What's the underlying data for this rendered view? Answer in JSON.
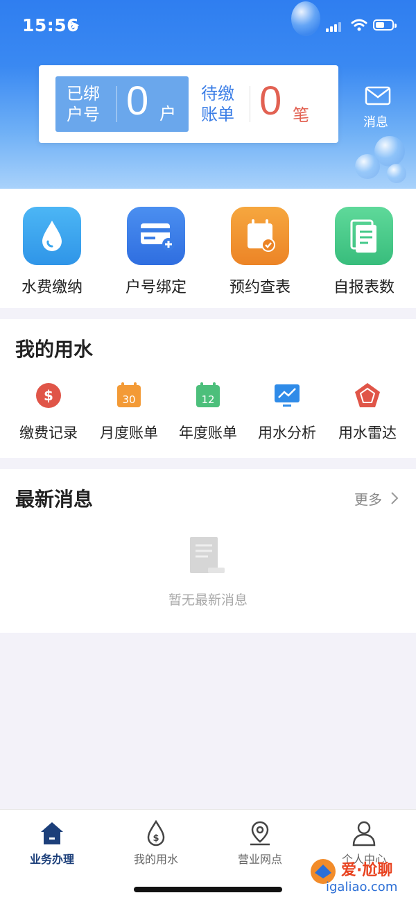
{
  "status_bar": {
    "time": "15:56"
  },
  "header": {
    "bound": {
      "label": "已绑户号",
      "count": "0",
      "unit": "户"
    },
    "pending": {
      "label": "待缴账单",
      "count": "0",
      "unit": "笔"
    },
    "message_label": "消息"
  },
  "services": [
    {
      "label": "水费缴纳",
      "icon": "water-drop-icon",
      "color": "#3aa6ef"
    },
    {
      "label": "户号绑定",
      "icon": "card-add-icon",
      "color": "#3a7de6"
    },
    {
      "label": "预约查表",
      "icon": "calendar-check-icon",
      "color": "#f0922e"
    },
    {
      "label": "自报表数",
      "icon": "document-icon",
      "color": "#44c98a"
    }
  ],
  "my_water": {
    "title": "我的用水",
    "items": [
      {
        "label": "缴费记录",
        "icon": "dollar-icon"
      },
      {
        "label": "月度账单",
        "icon": "calendar-30-icon",
        "badge": "30"
      },
      {
        "label": "年度账单",
        "icon": "calendar-12-icon",
        "badge": "12"
      },
      {
        "label": "用水分析",
        "icon": "chart-monitor-icon"
      },
      {
        "label": "用水雷达",
        "icon": "radar-icon"
      }
    ]
  },
  "news": {
    "title": "最新消息",
    "more_label": "更多",
    "empty_text": "暂无最新消息"
  },
  "tabbar": {
    "items": [
      {
        "label": "业务办理",
        "icon": "home-icon",
        "active": true
      },
      {
        "label": "我的用水",
        "icon": "water-dollar-icon"
      },
      {
        "label": "营业网点",
        "icon": "location-icon"
      },
      {
        "label": "个人中心",
        "icon": "person-icon"
      }
    ]
  },
  "watermark": {
    "text": "爱·尬聊",
    "sub": "igaliao.com"
  },
  "colors": {
    "primary": "#3a7de6",
    "danger": "#e26152",
    "header_top": "#2f7ef0"
  }
}
